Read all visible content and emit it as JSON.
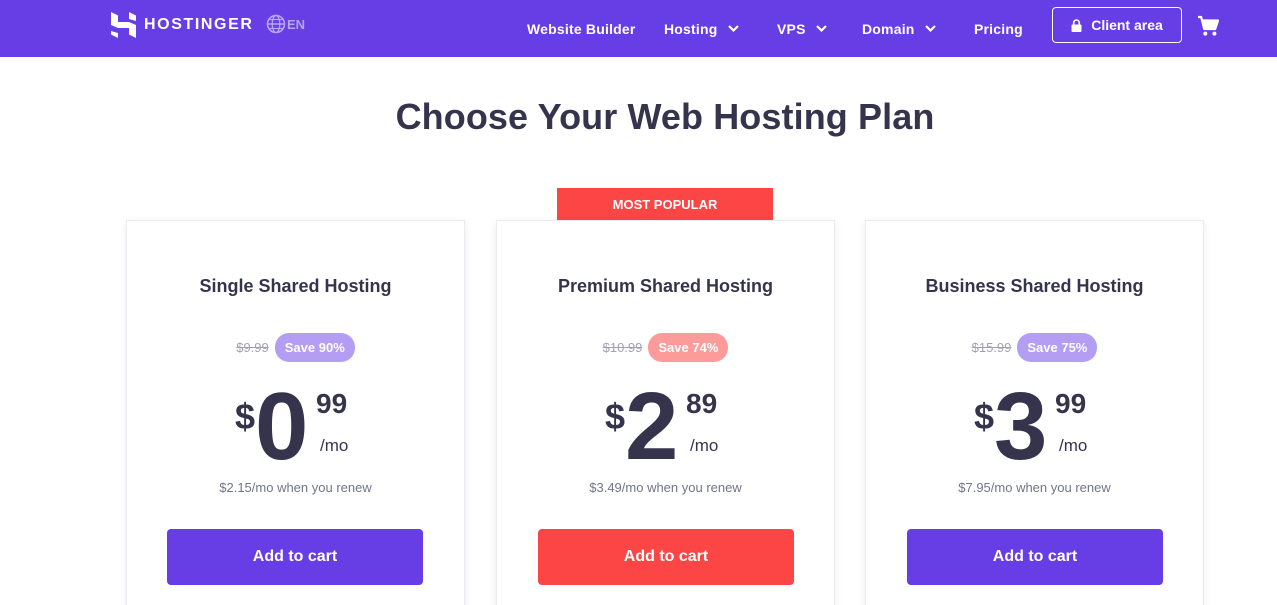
{
  "header": {
    "logo_text": "HOSTINGER",
    "language": "EN",
    "nav": [
      {
        "label": "Website Builder",
        "dropdown": false
      },
      {
        "label": "Hosting",
        "dropdown": true
      },
      {
        "label": "VPS",
        "dropdown": true
      },
      {
        "label": "Domain",
        "dropdown": true
      },
      {
        "label": "Pricing",
        "dropdown": false
      }
    ],
    "client_area_label": "Client area",
    "icons": [
      "hostinger-logo-icon",
      "globe-icon",
      "chevron-down-icon",
      "lock-icon",
      "cart-icon"
    ]
  },
  "main": {
    "title": "Choose Your Web Hosting Plan",
    "popular_badge": "MOST POPULAR",
    "plans": [
      {
        "name": "Single Shared Hosting",
        "old_price": "$9.99",
        "save_label": "Save 90%",
        "save_color": "#b39ef3",
        "currency": "$",
        "price_whole": "0",
        "price_cents": "99",
        "period": "/mo",
        "renew_text": "$2.15/mo when you renew",
        "button_label": "Add to cart",
        "button_color": "#673de6"
      },
      {
        "name": "Premium Shared Hosting",
        "old_price": "$10.99",
        "save_label": "Save 74%",
        "save_color": "#fd9b9b",
        "currency": "$",
        "price_whole": "2",
        "price_cents": "89",
        "period": "/mo",
        "renew_text": "$3.49/mo when you renew",
        "button_label": "Add to cart",
        "button_color": "#fc4545"
      },
      {
        "name": "Business Shared Hosting",
        "old_price": "$15.99",
        "save_label": "Save 75%",
        "save_color": "#b39ef3",
        "currency": "$",
        "price_whole": "3",
        "price_cents": "99",
        "period": "/mo",
        "renew_text": "$7.95/mo when you renew",
        "button_label": "Add to cart",
        "button_color": "#673de6"
      }
    ]
  },
  "colors": {
    "brand": "#673de6",
    "accent_red": "#fc4545",
    "text_dark": "#36344d"
  }
}
